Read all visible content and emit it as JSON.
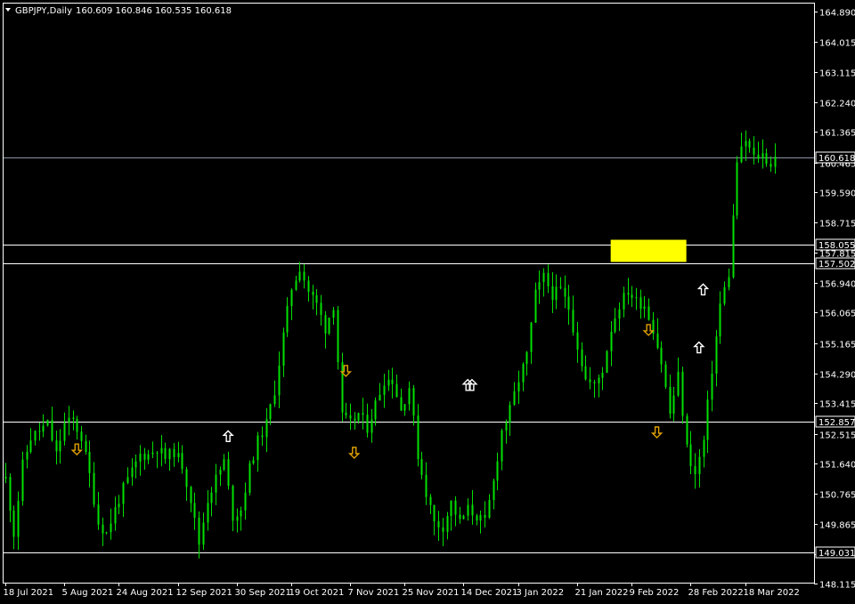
{
  "header": {
    "symbol_timeframe": "GBPJPY,Daily",
    "ohlc": "160.609 160.846 160.535 160.618"
  },
  "colors": {
    "background": "#000000",
    "candle": "#00e000",
    "grid_line": "#ffffff",
    "zone": "#ffff00",
    "arrow_down": "#e0a000",
    "arrow_up": "#ffffff",
    "axis_text": "#ffffff"
  },
  "chart_data": {
    "type": "candlestick",
    "ylim": [
      148.15,
      165.15
    ],
    "y_ticks": [
      "164.890",
      "164.015",
      "163.115",
      "162.240",
      "161.365",
      "160.465",
      "159.590",
      "158.715",
      "157.815",
      "156.940",
      "156.065",
      "155.165",
      "154.290",
      "153.415",
      "152.515",
      "151.640",
      "150.765",
      "149.865",
      "148.990",
      "148.115"
    ],
    "x_ticks": [
      {
        "label": "18 Jul 2021",
        "idx": 0
      },
      {
        "label": "5 Aug 2021",
        "idx": 14
      },
      {
        "label": "24 Aug 2021",
        "idx": 27
      },
      {
        "label": "12 Sep 2021",
        "idx": 41
      },
      {
        "label": "30 Sep 2021",
        "idx": 55
      },
      {
        "label": "19 Oct 2021",
        "idx": 68
      },
      {
        "label": "7 Nov 2021",
        "idx": 82
      },
      {
        "label": "25 Nov 2021",
        "idx": 95
      },
      {
        "label": "14 Dec 2021",
        "idx": 109
      },
      {
        "label": "3 Jan 2022",
        "idx": 122
      },
      {
        "label": "21 Jan 2022",
        "idx": 136
      },
      {
        "label": "9 Feb 2022",
        "idx": 149
      },
      {
        "label": "28 Feb 2022",
        "idx": 163
      },
      {
        "label": "18 Mar 2022",
        "idx": 176
      }
    ],
    "close_path": [
      [
        0,
        151.2
      ],
      [
        2,
        149.6
      ],
      [
        4,
        151.6
      ],
      [
        6,
        152.4
      ],
      [
        8,
        152.6
      ],
      [
        10,
        152.8
      ],
      [
        12,
        151.9
      ],
      [
        14,
        152.8
      ],
      [
        16,
        152.9
      ],
      [
        18,
        152.4
      ],
      [
        20,
        151.3
      ],
      [
        22,
        149.9
      ],
      [
        24,
        149.6
      ],
      [
        26,
        150.3
      ],
      [
        28,
        150.9
      ],
      [
        30,
        151.4
      ],
      [
        32,
        151.9
      ],
      [
        34,
        151.9
      ],
      [
        36,
        152.1
      ],
      [
        38,
        151.8
      ],
      [
        40,
        152.0
      ],
      [
        42,
        151.6
      ],
      [
        44,
        150.6
      ],
      [
        46,
        149.3
      ],
      [
        48,
        150.6
      ],
      [
        50,
        151.2
      ],
      [
        52,
        151.7
      ],
      [
        54,
        150.1
      ],
      [
        56,
        150.3
      ],
      [
        58,
        151.5
      ],
      [
        60,
        152.3
      ],
      [
        62,
        152.8
      ],
      [
        64,
        153.8
      ],
      [
        66,
        155.4
      ],
      [
        68,
        156.8
      ],
      [
        70,
        157.4
      ],
      [
        72,
        156.7
      ],
      [
        74,
        156.3
      ],
      [
        76,
        155.6
      ],
      [
        78,
        156.3
      ],
      [
        80,
        153.0
      ],
      [
        82,
        152.8
      ],
      [
        84,
        153.1
      ],
      [
        86,
        152.7
      ],
      [
        88,
        153.4
      ],
      [
        90,
        154.1
      ],
      [
        92,
        154.1
      ],
      [
        94,
        153.2
      ],
      [
        96,
        153.9
      ],
      [
        98,
        151.9
      ],
      [
        100,
        150.8
      ],
      [
        102,
        149.9
      ],
      [
        104,
        149.8
      ],
      [
        106,
        150.5
      ],
      [
        108,
        149.9
      ],
      [
        110,
        150.3
      ],
      [
        112,
        150.1
      ],
      [
        114,
        149.9
      ],
      [
        116,
        151.1
      ],
      [
        118,
        152.6
      ],
      [
        120,
        153.2
      ],
      [
        122,
        154.1
      ],
      [
        124,
        154.8
      ],
      [
        126,
        156.6
      ],
      [
        128,
        157.1
      ],
      [
        130,
        156.6
      ],
      [
        132,
        156.7
      ],
      [
        134,
        156.2
      ],
      [
        136,
        155.1
      ],
      [
        138,
        154.1
      ],
      [
        140,
        153.9
      ],
      [
        142,
        154.4
      ],
      [
        144,
        155.6
      ],
      [
        146,
        156.3
      ],
      [
        148,
        156.7
      ],
      [
        150,
        156.4
      ],
      [
        152,
        156.3
      ],
      [
        154,
        155.6
      ],
      [
        156,
        154.6
      ],
      [
        158,
        153.1
      ],
      [
        160,
        154.2
      ],
      [
        162,
        152.1
      ],
      [
        164,
        151.3
      ],
      [
        166,
        152.3
      ],
      [
        168,
        154.4
      ],
      [
        170,
        156.3
      ],
      [
        172,
        157.2
      ],
      [
        174,
        160.5
      ],
      [
        176,
        161.1
      ],
      [
        178,
        160.6
      ],
      [
        180,
        160.7
      ],
      [
        182,
        160.4
      ],
      [
        183,
        160.62
      ]
    ],
    "last_index": 183,
    "hlines": [
      {
        "label": "160.618",
        "price": 160.618,
        "style": "gray",
        "tagged": true
      },
      {
        "label": "158.055",
        "price": 158.055,
        "style": "white",
        "tagged": true
      },
      {
        "label": "157.502",
        "price": 157.502,
        "style": "white",
        "tagged": true
      },
      {
        "label": "152.857",
        "price": 152.857,
        "style": "white",
        "tagged": true
      },
      {
        "label": "149.031",
        "price": 149.031,
        "style": "white",
        "tagged": true
      }
    ],
    "zone": {
      "idx_start": 144,
      "idx_end": 162,
      "price_low": 157.55,
      "price_high": 158.2
    },
    "signals": [
      {
        "dir": "down",
        "idx": 17,
        "price": 151.9
      },
      {
        "dir": "up",
        "idx": 53,
        "price": 152.6
      },
      {
        "dir": "down",
        "idx": 81,
        "price": 154.2
      },
      {
        "dir": "down",
        "idx": 83,
        "price": 151.8
      },
      {
        "dir": "up",
        "idx": 110,
        "price": 154.1
      },
      {
        "dir": "up",
        "idx": 111,
        "price": 154.1
      },
      {
        "dir": "down",
        "idx": 153,
        "price": 155.4
      },
      {
        "dir": "down",
        "idx": 155,
        "price": 152.4
      },
      {
        "dir": "up",
        "idx": 165,
        "price": 155.2
      },
      {
        "dir": "up",
        "idx": 166,
        "price": 156.9
      }
    ]
  }
}
